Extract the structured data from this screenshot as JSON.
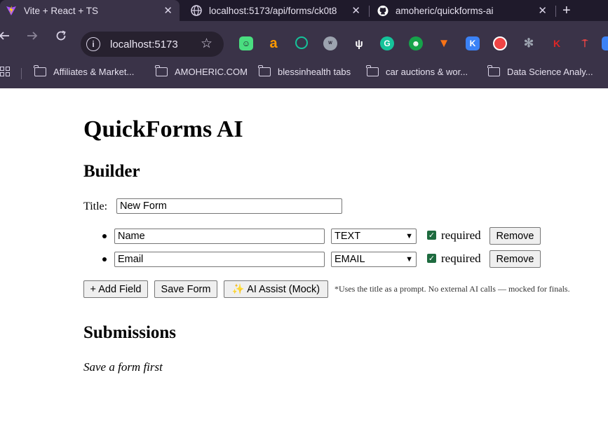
{
  "browser": {
    "tabs": [
      {
        "title": "Vite + React + TS",
        "icon": "vite-icon",
        "active": true
      },
      {
        "title": "localhost:5173/api/forms/ck0t8",
        "icon": "globe-icon",
        "active": false
      },
      {
        "title": "amoheric/quickforms-ai",
        "icon": "github-icon",
        "active": false
      }
    ],
    "new_tab_label": "+",
    "close_glyph": "✕",
    "url": "localhost:5173",
    "bookmarks": [
      "Affiliates & Market...",
      "AMOHERIC.COM",
      "blessinhealth tabs",
      "car auctions & wor...",
      "Data Science Analy..."
    ]
  },
  "page": {
    "app_title": "QuickForms AI",
    "builder_heading": "Builder",
    "title_label": "Title:",
    "title_value": "New Form",
    "fields": [
      {
        "label": "Name",
        "type": "TEXT",
        "required_label": "required",
        "remove_label": "Remove"
      },
      {
        "label": "Email",
        "type": "EMAIL",
        "required_label": "required",
        "remove_label": "Remove"
      }
    ],
    "add_field_label": "+ Add Field",
    "save_form_label": "Save Form",
    "ai_assist_label": "✨ AI Assist (Mock)",
    "ai_note": "*Uses the title as a prompt. No external AI calls — mocked for finals.",
    "submissions_heading": "Submissions",
    "submissions_empty": "Save a form first"
  },
  "colors": {
    "tabstrip": "#1f1a2b",
    "toolbar": "#3a3348",
    "checkbox": "#1e6b3f"
  }
}
